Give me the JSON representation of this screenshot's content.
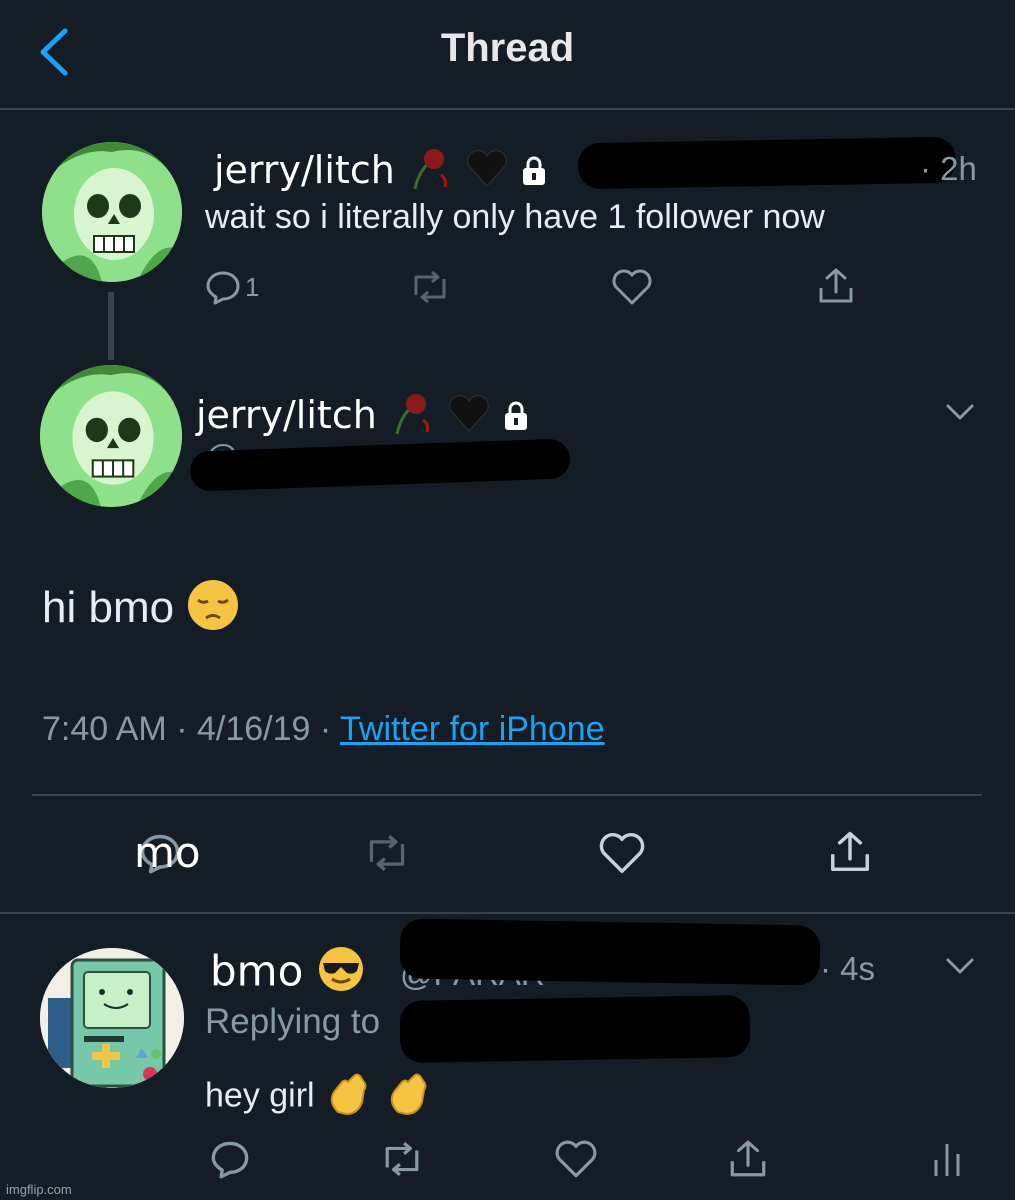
{
  "header": {
    "title": "Thread",
    "back_icon": "chevron-left-icon"
  },
  "tweet1": {
    "display_name": "jerry/litch",
    "time": "· 2h",
    "text": "wait so i literally only have 1 follower now",
    "reply_count": "1"
  },
  "main_tweet": {
    "display_name": "jerry/litch",
    "handle_partial": "@",
    "text": "hi bmo",
    "timestamp": "7:40 AM · 4/16/19 · ",
    "source": "Twitter for iPhone",
    "overlay_text": "mo"
  },
  "reply": {
    "display_name": "bmo",
    "handle_partial": "@PARAR",
    "time": "· 4s",
    "replying_to": "Replying to",
    "text": "hey girl"
  },
  "watermark": "imgflip.com",
  "colors": {
    "background": "#141d26",
    "divider": "#38444d",
    "link": "#1da1f2",
    "muted": "#8899a6"
  }
}
